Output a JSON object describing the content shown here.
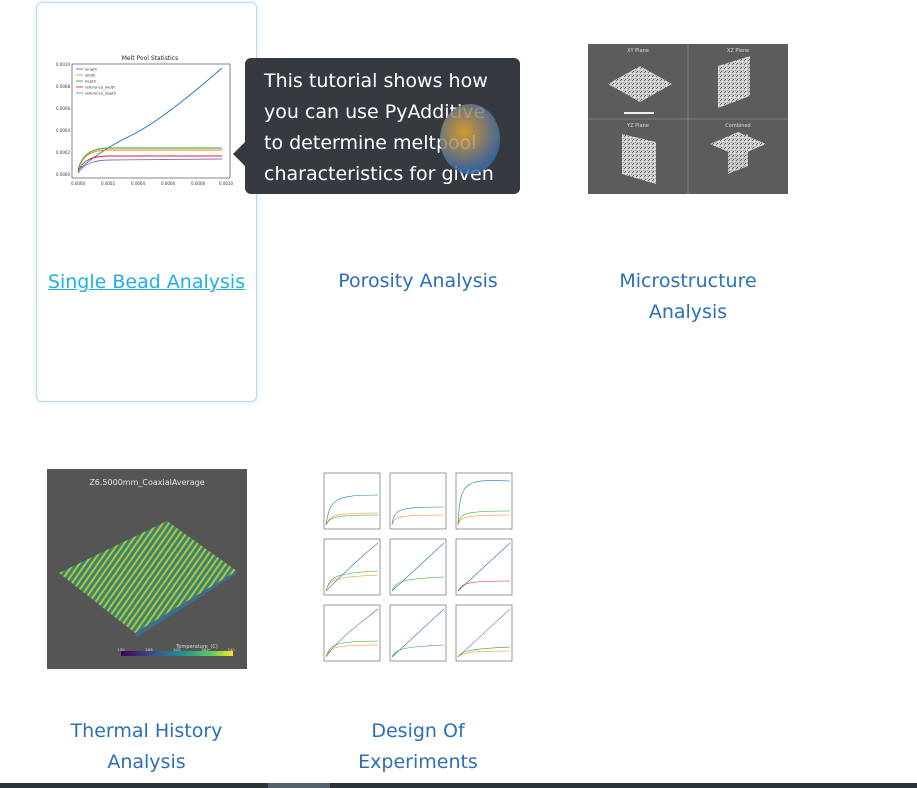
{
  "cards": [
    {
      "title": "Single Bead Analysis",
      "state": "hovered"
    },
    {
      "title": "Porosity Analysis"
    },
    {
      "title_lines": [
        "Microstructure",
        "Analysis"
      ]
    },
    {
      "title_lines": [
        "Thermal History",
        "Analysis"
      ]
    },
    {
      "title_lines": [
        "Design Of",
        "Experiments"
      ]
    }
  ],
  "tooltip": {
    "text": "This tutorial shows how you can use PyAdditive to determine meltpool characteristics for given …"
  },
  "thumb_single_bead": {
    "title": "Melt Pool Statistics",
    "legend": [
      "length",
      "width",
      "depth",
      "reference_width",
      "reference_depth"
    ],
    "yticks": [
      "0.0010",
      "0.0008",
      "0.0006",
      "0.0004",
      "0.0002",
      "0.0000"
    ],
    "xticks": [
      "0.0000",
      "0.0002",
      "0.0004",
      "0.0006",
      "0.0008",
      "0.0010"
    ],
    "colors": [
      "#1f77b4",
      "#ff7f0e",
      "#2ca02c",
      "#d62728",
      "#9467bd"
    ]
  },
  "thumb_microstructure": {
    "panels": [
      "XY Plane",
      "XZ Plane",
      "YZ Plane",
      "Combined"
    ]
  },
  "thumb_thermal": {
    "title": "Z6.5000mm_CoaxialAverage",
    "colorbar_label": "Temperature_(C)",
    "colorbar_ticks": [
      "150",
      "266",
      "425",
      "582",
      "740"
    ]
  },
  "colors": {
    "link": "#2a6fb8",
    "link_hover": "#22aee3",
    "tooltip_bg": "#343a40"
  }
}
